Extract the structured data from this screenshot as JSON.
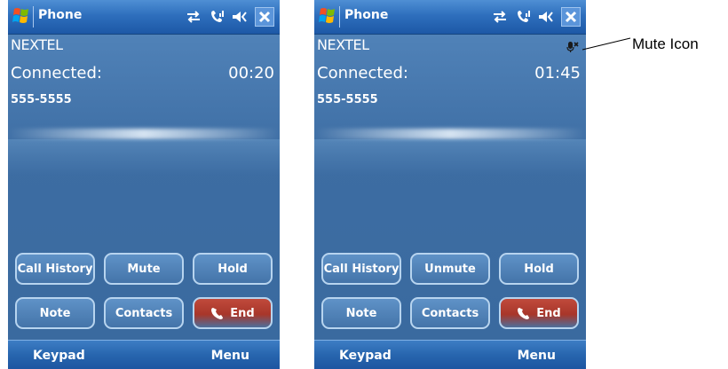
{
  "callout": {
    "label": "Mute Icon"
  },
  "screens": [
    {
      "title": "Phone",
      "carrier": "NEXTEL",
      "status": "Connected:",
      "timer": "00:20",
      "number": "555-5555",
      "buttons": {
        "call_history": "Call History",
        "mute_toggle": "Mute",
        "hold": "Hold",
        "note": "Note",
        "contacts": "Contacts",
        "end": "End"
      },
      "softkeys": {
        "left": "Keypad",
        "right": "Menu"
      },
      "muted": false
    },
    {
      "title": "Phone",
      "carrier": "NEXTEL",
      "status": "Connected:",
      "timer": "01:45",
      "number": "555-5555",
      "buttons": {
        "call_history": "Call History",
        "mute_toggle": "Unmute",
        "hold": "Hold",
        "note": "Note",
        "contacts": "Contacts",
        "end": "End"
      },
      "softkeys": {
        "left": "Keypad",
        "right": "Menu"
      },
      "muted": true
    }
  ],
  "icons": {
    "start": "windows-flag-icon",
    "connectivity": "connectivity-arrows-icon",
    "phone_signal": "phone-signal-icon",
    "volume": "speaker-volume-icon",
    "close": "close-icon",
    "mute_indicator": "microphone-muted-icon",
    "end_call": "phone-handset-icon"
  },
  "colors": {
    "titlebar": "#2e6fbd",
    "background": "#3d6da3",
    "button_border": "#b7d4ef",
    "end_button": "#b03a2e"
  }
}
